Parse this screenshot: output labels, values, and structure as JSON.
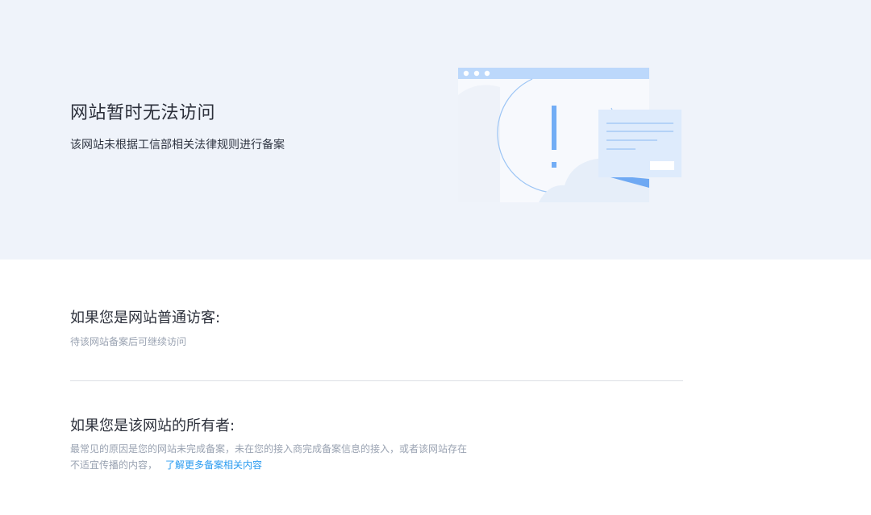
{
  "hero": {
    "title": "网站暂时无法访问",
    "subtitle": "该网站未根据工信部相关法律规则进行备案"
  },
  "visitor": {
    "title": "如果您是网站普通访客:",
    "text": "待该网站备案后可继续访问"
  },
  "owner": {
    "title": "如果您是该网站的所有者:",
    "text_line1": "最常见的原因是您的网站未完成备案，未在您的接入商完成备案信息的接入，或者该网站存在",
    "text_line2": "不适宜传播的内容，",
    "link": "了解更多备案相关内容"
  },
  "colors": {
    "hero_bg": "#eff3fa",
    "accent": "#2a9bf0",
    "illustration_blue": "#78b4f5"
  },
  "icons": {
    "illustration": "browser-warning-illustration",
    "exclamation": "exclamation-icon"
  }
}
